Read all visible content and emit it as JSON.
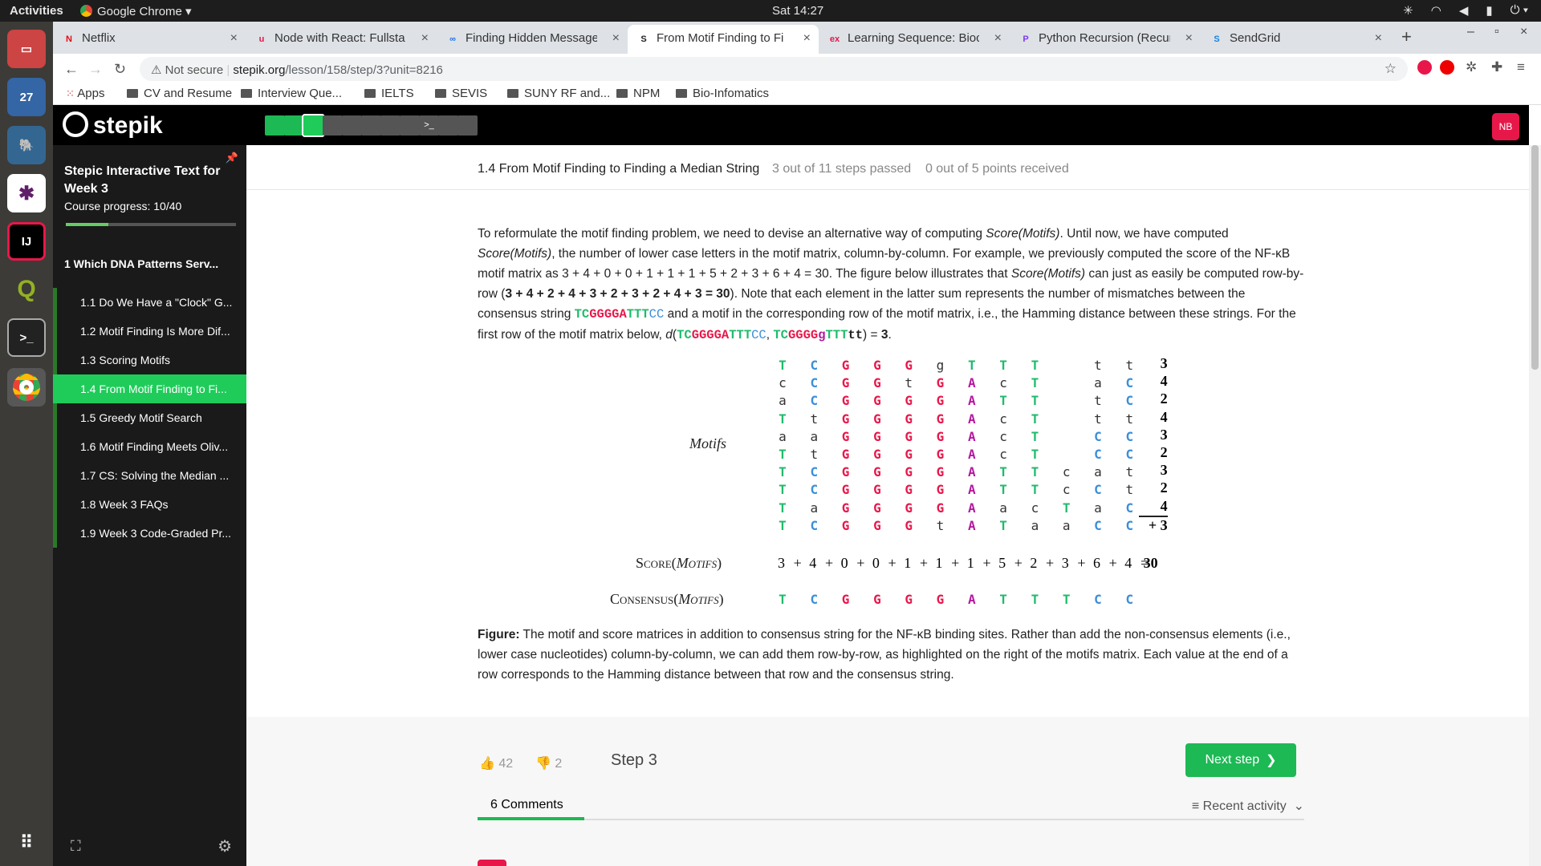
{
  "os": {
    "activities": "Activities",
    "app": "Google Chrome",
    "clock": "Sat 14:27",
    "calendar_day": "27"
  },
  "tabs": [
    {
      "label": "Netflix",
      "fav": "N",
      "fav_color": "#e50914"
    },
    {
      "label": "Node with React: Fullsta",
      "fav": "u",
      "fav_color": "#e8174a"
    },
    {
      "label": "Finding Hidden Message",
      "fav": "∞",
      "fav_color": "#1a73e8"
    },
    {
      "label": "From Motif Finding to Fi",
      "fav": "S",
      "fav_color": "#222"
    },
    {
      "label": "Learning Sequence: Bioc",
      "fav": "ex",
      "fav_color": "#e8174a"
    },
    {
      "label": "Python Recursion (Recur",
      "fav": "P",
      "fav_color": "#7c3aed"
    },
    {
      "label": "SendGrid",
      "fav": "S",
      "fav_color": "#1a82e2"
    }
  ],
  "address": {
    "security": "Not secure",
    "host": "stepik.org",
    "path": "/lesson/158/step/3?unit=8216"
  },
  "bookmarks": [
    "Apps",
    "CV and Resume",
    "Interview Que...",
    "IELTS",
    "SEVIS",
    "SUNY RF and...",
    "NPM",
    "Bio-Infomatics"
  ],
  "header": {
    "logo": "stepik",
    "avatar": "NB"
  },
  "sidebar": {
    "course_title": "Stepic Interactive Text for Week 3",
    "progress_label": "Course progress:  10/40",
    "progress": 0.25,
    "section": "1  Which DNA Patterns Serv...",
    "lessons": [
      "1.1  Do We Have a \"Clock\" G...",
      "1.2  Motif Finding Is More Dif...",
      "1.3  Scoring Motifs",
      "1.4  From Motif Finding to Fi...",
      "1.5  Greedy Motif Search",
      "1.6  Motif Finding Meets Oliv...",
      "1.7  CS: Solving the Median ...",
      "1.8  Week 3 FAQs",
      "1.9  Week 3 Code-Graded Pr..."
    ]
  },
  "lesson": {
    "title": "1.4 From Motif Finding to Finding a Median String",
    "steps_passed": "3 out of 11 steps passed",
    "points": "0 out of 5 points  received"
  },
  "text": {
    "p1": "To reformulate the motif finding problem, we need to devise an alternative way of computing ",
    "score_motifs": "Score",
    "motifs_word": "Motifs",
    "p2": ". Until now, we have computed ",
    "p3": ", the number of lower case letters in the motif matrix, column-by-column. For example, we previously computed the score of the NF-κB motif matrix as 3 + 4 + 0 + 0 + 1 + 1 + 1 + 5 + 2 + 3 + 6 + 4 = 30. The figure below illustrates that ",
    "p4": " can just as easily be computed row-by-row (",
    "rowsum": "3 + 4 + 2 + 4 + 3 + 2 + 3 + 2 + 4 + 3 = 30",
    "p5": "). Note that each element in the latter sum represents the number of mismatches between the consensus string ",
    "p6": " and a motif in the corresponding row of the motif matrix, i.e., the Hamming distance between these strings. For the first row of the motif matrix below, ",
    "d_label": "d",
    "p7": " = ",
    "d_val": "3",
    "p8": "."
  },
  "figure": {
    "motifs_label": "Motifs",
    "score_label": "Score(Motifs)",
    "consensus_label": "Consensus(Motifs)",
    "rows": [
      "TCGGGgTTTtt",
      "cCGGtGAcTaC",
      "aCGGGGATTtC",
      "TtGGGGAcTtt",
      "aaGGGGAcTCC",
      "TtGGGGAcTCC",
      "TCGGGGATTcat",
      "TCGGGGATTcCt",
      "TaGGGGAacTaC",
      "TCGGGtATaaCC"
    ],
    "row_scores": [
      "3",
      "4",
      "2",
      "4",
      "3",
      "2",
      "3",
      "2",
      "4",
      "+ 3"
    ],
    "column_scores": [
      "3",
      "+",
      "4",
      "+",
      "0",
      "+",
      "0",
      "+",
      "1",
      "+",
      "1",
      "+",
      "1",
      "+",
      "5",
      "+",
      "2",
      "+",
      "3",
      "+",
      "6",
      "+",
      "4",
      "=",
      "30"
    ],
    "consensus": "TCGGGGATTTCC",
    "caption_bold": "Figure:",
    "caption": " The motif and score matrices in addition to consensus string for the NF-κB binding sites. Rather than add the non-consensus elements (i.e., lower case nucleotides) column-by-column, we can add them row-by-row, as highlighted on the right of the motifs matrix. Each value at the end of a row corresponds to the Hamming distance between that row and the consensus string."
  },
  "footer": {
    "likes": "42",
    "dislikes": "2",
    "step": "Step 3",
    "next": "Next step",
    "comments_tab": "6  Comments",
    "sort": "Recent activity"
  }
}
